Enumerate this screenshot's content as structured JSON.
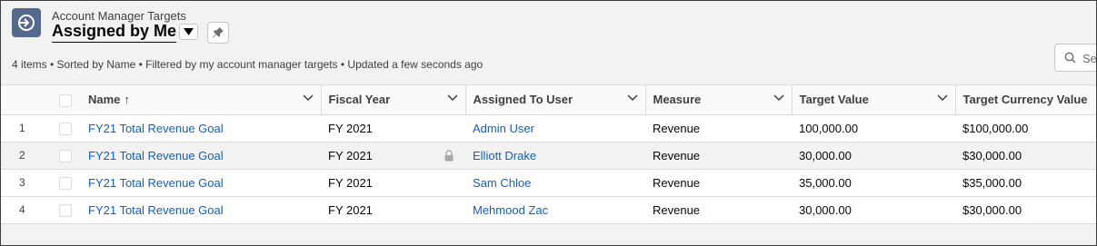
{
  "header": {
    "object_label": "Account Manager Targets",
    "view_title": "Assigned by Me",
    "summary": "4 items • Sorted by Name • Filtered by my account manager targets • Updated a few seconds ago"
  },
  "search": {
    "placeholder": "Search this list..."
  },
  "table": {
    "columns": [
      "Name",
      "Fiscal Year",
      "Assigned To User",
      "Measure",
      "Target Value",
      "Target Currency Value"
    ],
    "sort_indicator": "↑",
    "rows": [
      {
        "num": "1",
        "name": "FY21 Total Revenue Goal",
        "fiscal_year": "FY 2021",
        "assigned_to": "Admin User",
        "measure": "Revenue",
        "target_value": "100,000.00",
        "currency_value": "$100,000.00"
      },
      {
        "num": "2",
        "name": "FY21 Total Revenue Goal",
        "fiscal_year": "FY 2021",
        "assigned_to": "Elliott Drake",
        "measure": "Revenue",
        "target_value": "30,000.00",
        "currency_value": "$30,000.00"
      },
      {
        "num": "3",
        "name": "FY21 Total Revenue Goal",
        "fiscal_year": "FY 2021",
        "assigned_to": "Sam Chloe",
        "measure": "Revenue",
        "target_value": "35,000.00",
        "currency_value": "$35,000.00"
      },
      {
        "num": "4",
        "name": "FY21 Total Revenue Goal",
        "fiscal_year": "FY 2021",
        "assigned_to": "Mehmood Zac",
        "measure": "Revenue",
        "target_value": "30,000.00",
        "currency_value": "$30,000.00"
      }
    ]
  },
  "colors": {
    "app_icon_bg": "#54698d",
    "link": "#1060bd",
    "hover_row": "#f3f2f2"
  }
}
